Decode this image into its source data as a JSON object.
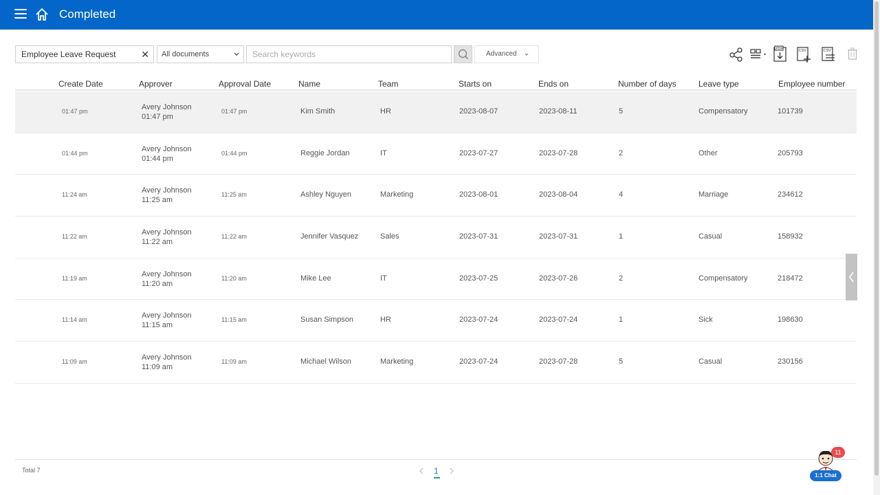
{
  "header": {
    "title": "Completed",
    "menu_icon": "hamburger-menu-icon",
    "home_icon": "home-icon",
    "background": "#0466c8"
  },
  "toolbar": {
    "filter_value": "Employee Leave Request",
    "doc_select_value": "All documents",
    "search_placeholder": "Search keywords",
    "advanced_label": "Advanced",
    "icons": [
      "share-icon",
      "column-layout-icon",
      "export-pdf-icon",
      "add-csv-icon",
      "csv-list-icon",
      "trash-icon"
    ]
  },
  "table": {
    "columns": [
      "Create Date",
      "Approver",
      "Approval Date",
      "Name",
      "Team",
      "Starts on",
      "Ends on",
      "Number of days",
      "Leave type",
      "Employee number"
    ],
    "rows": [
      {
        "create": "01:47 pm",
        "approver": "Avery Johnson",
        "approver_time": "01:47 pm",
        "approval": "01:47 pm",
        "name": "Kim Smith",
        "team": "HR",
        "start": "2023-08-07",
        "end": "2023-08-11",
        "days": "5",
        "type": "Compensatory",
        "emp": "101739"
      },
      {
        "create": "01:44 pm",
        "approver": "Avery Johnson",
        "approver_time": "01:44 pm",
        "approval": "01:44 pm",
        "name": "Reggie Jordan",
        "team": "IT",
        "start": "2023-07-27",
        "end": "2023-07-28",
        "days": "2",
        "type": "Other",
        "emp": "205793"
      },
      {
        "create": "11:24 am",
        "approver": "Avery Johnson",
        "approver_time": "11:25 am",
        "approval": "11:25 am",
        "name": "Ashley Nguyen",
        "team": "Marketing",
        "start": "2023-08-01",
        "end": "2023-08-04",
        "days": "4",
        "type": "Marriage",
        "emp": "234612"
      },
      {
        "create": "11:22 am",
        "approver": "Avery Johnson",
        "approver_time": "11:22 am",
        "approval": "11:22 am",
        "name": "Jennifer Vasquez",
        "team": "Sales",
        "start": "2023-07-31",
        "end": "2023-07-31",
        "days": "1",
        "type": "Casual",
        "emp": "158932"
      },
      {
        "create": "11:19 am",
        "approver": "Avery Johnson",
        "approver_time": "11:20 am",
        "approval": "11:20 am",
        "name": "Mike Lee",
        "team": "IT",
        "start": "2023-07-25",
        "end": "2023-07-26",
        "days": "2",
        "type": "Compensatory",
        "emp": "218472"
      },
      {
        "create": "11:14 am",
        "approver": "Avery Johnson",
        "approver_time": "11:15 am",
        "approval": "11:15 am",
        "name": "Susan Simpson",
        "team": "HR",
        "start": "2023-07-24",
        "end": "2023-07-24",
        "days": "1",
        "type": "Sick",
        "emp": "198630"
      },
      {
        "create": "11:09 am",
        "approver": "Avery Johnson",
        "approver_time": "11:09 am",
        "approval": "11:09 am",
        "name": "Michael Wilson",
        "team": "Marketing",
        "start": "2023-07-24",
        "end": "2023-07-28",
        "days": "5",
        "type": "Casual",
        "emp": "230156"
      }
    ]
  },
  "footer": {
    "total": "Total 7",
    "current_page": "1"
  },
  "chat": {
    "label": "1:1 Chat",
    "badge": "11"
  }
}
